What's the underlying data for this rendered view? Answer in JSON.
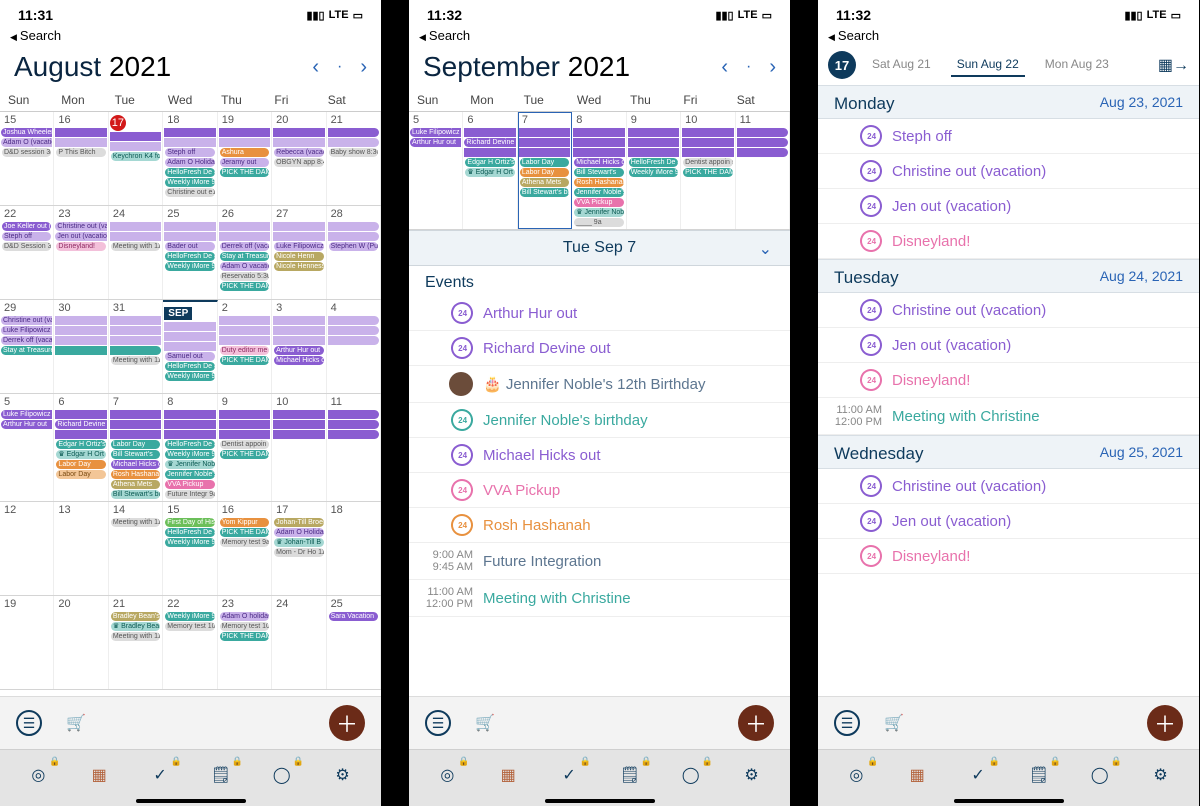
{
  "status": {
    "time1": "11:31",
    "time2": "11:32",
    "time3": "11:32",
    "net": "LTE"
  },
  "nav": {
    "back": "Search"
  },
  "dow": [
    "Sun",
    "Mon",
    "Tue",
    "Wed",
    "Thu",
    "Fri",
    "Sat"
  ],
  "panel1": {
    "month": "August",
    "year": "2021",
    "weeks": [
      {
        "days": [
          "15",
          "16",
          "17",
          "18",
          "19",
          "20",
          "21"
        ],
        "today_idx": 2,
        "bars": [
          {
            "row": 0,
            "start": 0,
            "end": 6,
            "cls": "purple",
            "label": "Joshua Wheeler"
          },
          {
            "row": 1,
            "start": 0,
            "end": 6,
            "cls": "purple-lt",
            "label": "Adam O (vacation)"
          }
        ],
        "chips": [
          {
            "day": 0,
            "cls": "gray-lt",
            "label": "D&D session 3p"
          },
          {
            "day": 1,
            "cls": "gray-lt",
            "label": "P This Bitch"
          },
          {
            "day": 2,
            "cls": "teal-lt",
            "label": "Keychron K4 fo"
          },
          {
            "day": 3,
            "cls": "purple-lt",
            "label": "Steph off"
          },
          {
            "day": 3,
            "cls": "purple-lt",
            "label": "Adam O Holiday"
          },
          {
            "day": 3,
            "cls": "teal",
            "label": "HelloFresh De 8a"
          },
          {
            "day": 3,
            "cls": "teal",
            "label": "Weekly iMore 9a"
          },
          {
            "day": 3,
            "cls": "gray-lt",
            "label": "Christine out e1p"
          },
          {
            "day": 4,
            "cls": "orange",
            "label": "Ashura"
          },
          {
            "day": 4,
            "cls": "purple-lt",
            "label": "Jeramy out"
          },
          {
            "day": 4,
            "cls": "teal",
            "label": "PICK THE DAM 6p"
          },
          {
            "day": 5,
            "cls": "purple-lt",
            "label": "Rebecca (vacat"
          },
          {
            "day": 5,
            "cls": "gray-lt",
            "label": "OBGYN app 8:45a"
          },
          {
            "day": 6,
            "cls": "gray-lt",
            "label": "Baby show 8:30a"
          }
        ]
      },
      {
        "days": [
          "22",
          "23",
          "24",
          "25",
          "26",
          "27",
          "28"
        ],
        "bars": [
          {
            "row": 0,
            "start": 1,
            "end": 6,
            "cls": "purple-lt",
            "label": "Christine out (vacation)"
          },
          {
            "row": 2,
            "start": 1,
            "end": 6,
            "cls": "purple-lt",
            "label": "Jen out (vacation)"
          }
        ],
        "chips": [
          {
            "day": 0,
            "cls": "purple",
            "label": "Joe Keller out (v"
          },
          {
            "day": 0,
            "cls": "purple-lt",
            "label": "Steph off"
          },
          {
            "day": 0,
            "cls": "gray-lt",
            "label": "D&D Session 3p"
          },
          {
            "day": 1,
            "cls": "pink-lt",
            "label": "Disneyland!"
          },
          {
            "day": 2,
            "cls": "gray-lt",
            "label": "Meeting with 11a"
          },
          {
            "day": 3,
            "cls": "purple-lt",
            "label": "Bader out"
          },
          {
            "day": 3,
            "cls": "teal",
            "label": "HelloFresh De 8a"
          },
          {
            "day": 3,
            "cls": "teal",
            "label": "Weekly iMore 9a"
          },
          {
            "day": 4,
            "cls": "purple-lt",
            "label": "Derrek off (vacation)"
          },
          {
            "day": 4,
            "cls": "teal",
            "label": "Stay at Treasure Island - TI Hotel & Casino, a Radisson"
          },
          {
            "day": 4,
            "cls": "purple-lt",
            "label": "Adam O vacation"
          },
          {
            "day": 4,
            "cls": "gray-lt",
            "label": "Reservatio 5:30p"
          },
          {
            "day": 4,
            "cls": "teal",
            "label": "PICK THE DAM 6p"
          },
          {
            "day": 5,
            "cls": "purple-lt",
            "label": "Luke Filipowicz (vacation)"
          },
          {
            "day": 5,
            "cls": "olive",
            "label": "Nicole Henn"
          },
          {
            "day": 5,
            "cls": "olive",
            "label": "Nicole Hennessy"
          },
          {
            "day": 6,
            "cls": "purple-lt",
            "label": "Stephen W (Pub"
          }
        ]
      },
      {
        "days": [
          "29",
          "30",
          "31",
          "SEP",
          "2",
          "3",
          "4"
        ],
        "sep_idx": 3,
        "bars": [
          {
            "row": 0,
            "start": 0,
            "end": 6,
            "cls": "purple-lt",
            "label": "Christine out (va"
          },
          {
            "row": 1,
            "start": 0,
            "end": 6,
            "cls": "purple-lt",
            "label": "Luke Filipowicz (vacation)"
          },
          {
            "row": 2,
            "start": 0,
            "end": 6,
            "cls": "purple-lt",
            "label": "Derrek off (vacation)"
          },
          {
            "row": 3,
            "start": 0,
            "end": 2,
            "cls": "teal",
            "label": "Stay at Treasure"
          }
        ],
        "chips": [
          {
            "day": 2,
            "cls": "gray-lt",
            "label": "Meeting with 11a"
          },
          {
            "day": 3,
            "cls": "purple-lt",
            "label": "Samuel out"
          },
          {
            "day": 3,
            "cls": "teal",
            "label": "HelloFresh De 8a"
          },
          {
            "day": 3,
            "cls": "teal",
            "label": "Weekly iMore 9a"
          },
          {
            "day": 4,
            "cls": "pink-lt",
            "label": "Duty editor me 8a"
          },
          {
            "day": 4,
            "cls": "teal",
            "label": "PICK THE DAM 6p"
          },
          {
            "day": 5,
            "cls": "purple",
            "label": "Arthur Hur out"
          },
          {
            "day": 5,
            "cls": "purple",
            "label": "Michael Hicks o"
          }
        ]
      },
      {
        "days": [
          "5",
          "6",
          "7",
          "8",
          "9",
          "10",
          "11"
        ],
        "bars": [
          {
            "row": 0,
            "start": 0,
            "end": 6,
            "cls": "purple",
            "label": "Luke Filipowicz o"
          },
          {
            "row": 0,
            "start": 1,
            "end": 6,
            "cls": "purple",
            "label": "Richard Devine out"
          },
          {
            "row": 1,
            "start": 0,
            "end": 6,
            "cls": "purple",
            "label": "Arthur Hur out"
          }
        ],
        "chips": [
          {
            "day": 1,
            "cls": "teal",
            "label": "Edgar H Ortiz's"
          },
          {
            "day": 1,
            "cls": "teal-lt",
            "label": "♛ Edgar H Ort"
          },
          {
            "day": 1,
            "cls": "orange",
            "label": "Labor Day"
          },
          {
            "day": 1,
            "cls": "orange-lt",
            "label": "Labor Day"
          },
          {
            "day": 2,
            "cls": "teal",
            "label": "Labor Day"
          },
          {
            "day": 2,
            "cls": "teal",
            "label": "Bill Stewart's"
          },
          {
            "day": 2,
            "cls": "purple",
            "label": "Michael Hicks o"
          },
          {
            "day": 2,
            "cls": "orange",
            "label": "Rosh Hashanah"
          },
          {
            "day": 2,
            "cls": "olive",
            "label": "Athena Mets"
          },
          {
            "day": 2,
            "cls": "teal-lt",
            "label": "Bill Stewart's bir"
          },
          {
            "day": 3,
            "cls": "teal",
            "label": "HelloFresh De 8a"
          },
          {
            "day": 3,
            "cls": "teal",
            "label": "Weekly iMore 9a"
          },
          {
            "day": 3,
            "cls": "teal-lt",
            "label": "♛ Jennifer Nob"
          },
          {
            "day": 3,
            "cls": "teal",
            "label": "Jennifer Noble's"
          },
          {
            "day": 3,
            "cls": "pink",
            "label": "VVA Pickup"
          },
          {
            "day": 3,
            "cls": "gray-lt",
            "label": "Future Integr 9a"
          },
          {
            "day": 4,
            "cls": "gray-lt",
            "label": "Dentist appoin 9a"
          },
          {
            "day": 4,
            "cls": "teal",
            "label": "PICK THE DAM 6p"
          }
        ]
      },
      {
        "days": [
          "12",
          "13",
          "14",
          "15",
          "16",
          "17",
          "18"
        ],
        "chips": [
          {
            "day": 2,
            "cls": "gray-lt",
            "label": "Meeting with 11a"
          },
          {
            "day": 3,
            "cls": "green",
            "label": "First Day of Hisp"
          },
          {
            "day": 3,
            "cls": "teal",
            "label": "HelloFresh De 8a"
          },
          {
            "day": 3,
            "cls": "teal",
            "label": "Weekly iMore 9a"
          },
          {
            "day": 4,
            "cls": "orange",
            "label": "Yom Kippur"
          },
          {
            "day": 4,
            "cls": "teal",
            "label": "PICK THE DAM 6p"
          },
          {
            "day": 4,
            "cls": "gray-lt",
            "label": "Memory test 9a"
          },
          {
            "day": 5,
            "cls": "olive",
            "label": "Johan-Till Broer"
          },
          {
            "day": 5,
            "cls": "purple-lt",
            "label": "Adam O Holiday"
          },
          {
            "day": 5,
            "cls": "teal-lt",
            "label": "♛ Johan-Till B"
          },
          {
            "day": 5,
            "cls": "gray-lt",
            "label": "Mom - Dr Ho 11a"
          }
        ]
      },
      {
        "days": [
          "19",
          "20",
          "21",
          "22",
          "23",
          "24",
          "25"
        ],
        "chips": [
          {
            "day": 2,
            "cls": "olive",
            "label": "Bradley Bean's b"
          },
          {
            "day": 2,
            "cls": "teal-lt",
            "label": "♛ Bradley Bea"
          },
          {
            "day": 2,
            "cls": "gray-lt",
            "label": "Meeting with 11a"
          },
          {
            "day": 3,
            "cls": "teal",
            "label": "Weekly iMore 9a"
          },
          {
            "day": 3,
            "cls": "gray-lt",
            "label": "Memory test 10a"
          },
          {
            "day": 4,
            "cls": "purple-lt",
            "label": "Adam O holiday"
          },
          {
            "day": 4,
            "cls": "gray-lt",
            "label": "Memory test 10a"
          },
          {
            "day": 4,
            "cls": "teal",
            "label": "PICK THE DAM 6p"
          },
          {
            "day": 6,
            "cls": "purple",
            "label": "Sara Vacation"
          }
        ]
      }
    ]
  },
  "panel2": {
    "month": "September",
    "year": "2021",
    "week": {
      "days": [
        "5",
        "6",
        "7",
        "8",
        "9",
        "10",
        "11"
      ],
      "sel_idx": 2,
      "bars": [
        {
          "row": 0,
          "start": 0,
          "end": 6,
          "cls": "purple",
          "label": "Luke Filipowicz ("
        },
        {
          "row": 0,
          "start": 1,
          "end": 6,
          "cls": "purple",
          "label": "Richard Devine out"
        },
        {
          "row": 1,
          "start": 0,
          "end": 6,
          "cls": "purple",
          "label": "Arthur Hur out"
        }
      ],
      "chips": [
        {
          "day": 1,
          "cls": "teal",
          "label": "Edgar H Ortiz's"
        },
        {
          "day": 1,
          "cls": "teal-lt",
          "label": "♛ Edgar H Ort"
        },
        {
          "day": 2,
          "cls": "teal",
          "label": "Labor Day"
        },
        {
          "day": 2,
          "cls": "orange",
          "label": "Labor Day"
        },
        {
          "day": 2,
          "cls": "olive",
          "label": "Athena Mets"
        },
        {
          "day": 2,
          "cls": "teal",
          "label": "Bill Stewart's bir"
        },
        {
          "day": 3,
          "cls": "purple",
          "label": "Michael Hicks o"
        },
        {
          "day": 3,
          "cls": "teal",
          "label": "Bill Stewart's"
        },
        {
          "day": 3,
          "cls": "orange",
          "label": "Rosh Hashanah"
        },
        {
          "day": 3,
          "cls": "teal",
          "label": "Jennifer Noble's"
        },
        {
          "day": 3,
          "cls": "pink",
          "label": "VVA Pickup"
        },
        {
          "day": 3,
          "cls": "teal-lt",
          "label": "♛ Jennifer Nob"
        },
        {
          "day": 3,
          "cls": "gray-lt",
          "label": "____ 9a"
        },
        {
          "day": 4,
          "cls": "teal",
          "label": "HelloFresh De 8a"
        },
        {
          "day": 4,
          "cls": "teal",
          "label": "Weekly iMore 9a"
        },
        {
          "day": 5,
          "cls": "gray-lt",
          "label": "Dentist appoin 9a"
        },
        {
          "day": 5,
          "cls": "teal",
          "label": "PICK THE DAM 6p"
        }
      ]
    },
    "selected_label": "Tue  Sep 7",
    "events_header": "Events",
    "events": [
      {
        "icon": "allday",
        "color": "t-purple",
        "title": "Arthur Hur out"
      },
      {
        "icon": "allday",
        "color": "t-purple",
        "title": "Richard Devine out"
      },
      {
        "icon": "avatar",
        "color": "t-steel",
        "title": "🎂 Jennifer Noble's 12th Birthday"
      },
      {
        "icon": "allday",
        "color": "t-teal",
        "title": "Jennifer Noble's birthday"
      },
      {
        "icon": "allday",
        "color": "t-purple",
        "title": "Michael Hicks out"
      },
      {
        "icon": "allday",
        "color": "t-pink",
        "title": "VVA Pickup"
      },
      {
        "icon": "allday",
        "color": "t-orange",
        "title": "Rosh Hashanah"
      },
      {
        "time1": "9:00 AM",
        "time2": "9:45 AM",
        "color": "t-steel",
        "title": "Future Integration"
      },
      {
        "time1": "11:00 AM",
        "time2": "12:00 PM",
        "color": "t-teal",
        "title": "Meeting with Christine"
      }
    ]
  },
  "panel3": {
    "today_badge": "17",
    "strip": [
      {
        "label": "Sat  Aug 21",
        "sel": false
      },
      {
        "label": "Sun  Aug 22",
        "sel": true
      },
      {
        "label": "Mon  Aug 23",
        "sel": false
      }
    ],
    "sections": [
      {
        "title": "Monday",
        "date": "Aug 23, 2021",
        "items": [
          {
            "icon": "allday",
            "color": "t-purple",
            "title": "Steph off"
          },
          {
            "icon": "allday",
            "color": "t-purple",
            "title": "Christine out (vacation)"
          },
          {
            "icon": "allday",
            "color": "t-purple",
            "title": "Jen out (vacation)"
          },
          {
            "icon": "allday",
            "color": "t-pink",
            "title": "Disneyland!"
          }
        ]
      },
      {
        "title": "Tuesday",
        "date": "Aug 24, 2021",
        "items": [
          {
            "icon": "allday",
            "color": "t-purple",
            "title": "Christine out (vacation)"
          },
          {
            "icon": "allday",
            "color": "t-purple",
            "title": "Jen out (vacation)"
          },
          {
            "icon": "allday",
            "color": "t-pink",
            "title": "Disneyland!"
          },
          {
            "time1": "11:00 AM",
            "time2": "12:00 PM",
            "color": "t-teal",
            "title": "Meeting with Christine"
          }
        ]
      },
      {
        "title": "Wednesday",
        "date": "Aug 25, 2021",
        "items": [
          {
            "icon": "allday",
            "color": "t-purple",
            "title": "Christine out (vacation)"
          },
          {
            "icon": "allday",
            "color": "t-purple",
            "title": "Jen out (vacation)"
          },
          {
            "icon": "allday",
            "color": "t-pink",
            "title": "Disneyland!"
          }
        ]
      }
    ]
  }
}
